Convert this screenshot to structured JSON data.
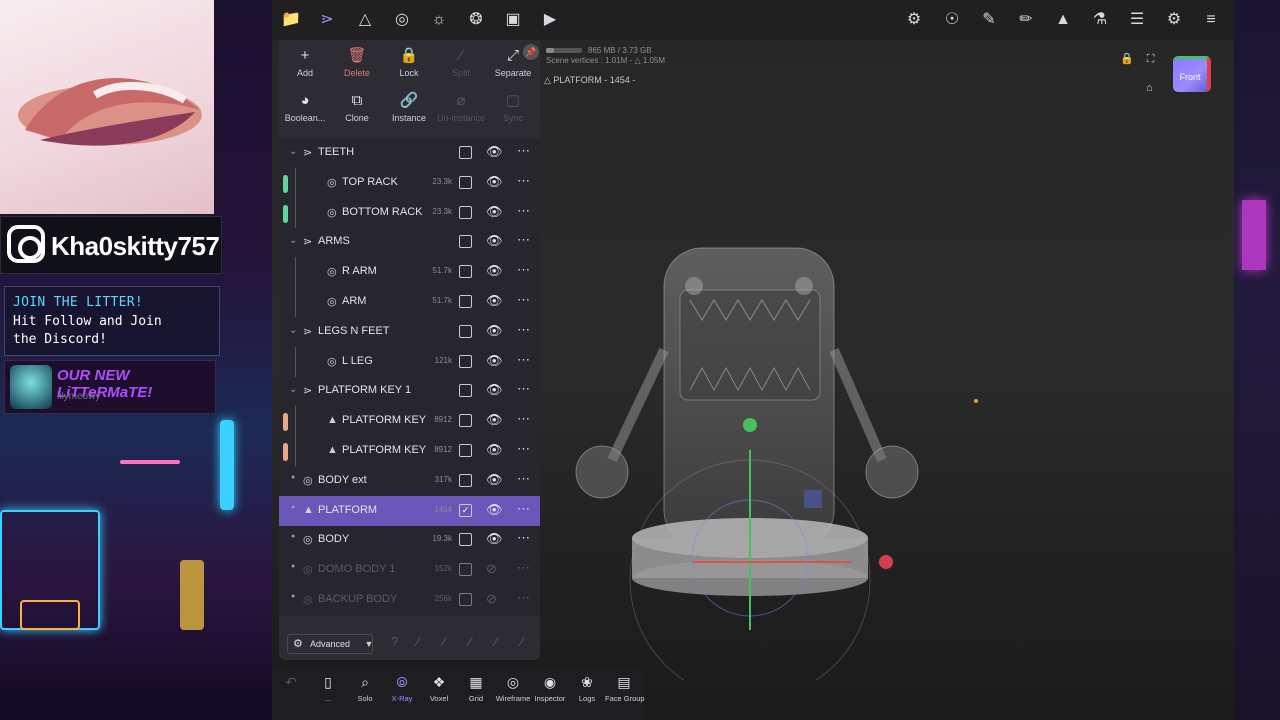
{
  "overlay": {
    "instagram_handle": "Kha0skitty757",
    "join_title": "JOIN THE LITTER!",
    "join_subtitle": "Hit Follow and Join the Discord!",
    "new_mate_title": "OUR NEW LiTTeRMaTE!",
    "new_mate_name": "lilymeowy"
  },
  "toolbar": {
    "actions": [
      {
        "label": "Add",
        "icon": "plus-icon",
        "enabled": true
      },
      {
        "label": "Delete",
        "icon": "trash-icon",
        "enabled": true,
        "accent": "#e07a7a"
      },
      {
        "label": "Lock",
        "icon": "lock-icon",
        "enabled": true
      },
      {
        "label": "Split",
        "icon": "split-icon",
        "enabled": false
      },
      {
        "label": "Separate",
        "icon": "expand-icon",
        "enabled": true
      },
      {
        "label": "Boolean...",
        "icon": "boolean-icon",
        "enabled": true
      },
      {
        "label": "Clone",
        "icon": "clone-icon",
        "enabled": true
      },
      {
        "label": "Instance",
        "icon": "link-icon",
        "enabled": true
      },
      {
        "label": "Un-instance",
        "icon": "unlink-icon",
        "enabled": false
      },
      {
        "label": "Sync",
        "icon": "sync-icon",
        "enabled": false
      }
    ]
  },
  "scene": {
    "rows": [
      {
        "name": "TEETH",
        "count": "",
        "type": "group",
        "level": 0,
        "checked": false,
        "visible": true
      },
      {
        "name": "TOP RACK",
        "count": "23.3k",
        "type": "mesh",
        "level": 1,
        "checked": false,
        "visible": true,
        "tag": "#5fd6a0"
      },
      {
        "name": "BOTTOM RACK",
        "count": "23.3k",
        "type": "mesh",
        "level": 1,
        "checked": false,
        "visible": true,
        "tag": "#5fd6a0"
      },
      {
        "name": "ARMS",
        "count": "",
        "type": "group",
        "level": 0,
        "checked": false,
        "visible": true
      },
      {
        "name": "R ARM",
        "count": "51.7k",
        "type": "mesh",
        "level": 1,
        "checked": false,
        "visible": true
      },
      {
        "name": "ARM",
        "count": "51.7k",
        "type": "mesh",
        "level": 1,
        "checked": false,
        "visible": true
      },
      {
        "name": "LEGS N FEET",
        "count": "",
        "type": "group",
        "level": 0,
        "checked": false,
        "visible": true
      },
      {
        "name": "L LEG",
        "count": "121k",
        "type": "mesh",
        "level": 1,
        "checked": false,
        "visible": true
      },
      {
        "name": "PLATFORM KEY 1",
        "count": "",
        "type": "group",
        "level": 0,
        "checked": false,
        "visible": true
      },
      {
        "name": "PLATFORM KEY",
        "count": "8912",
        "type": "tri",
        "level": 1,
        "checked": false,
        "visible": true,
        "tag": "#e8a88a"
      },
      {
        "name": "PLATFORM KEY",
        "count": "8912",
        "type": "tri",
        "level": 1,
        "checked": false,
        "visible": true,
        "tag": "#e8a88a"
      },
      {
        "name": "BODY ext",
        "count": "317k",
        "type": "mesh",
        "level": 0,
        "checked": false,
        "visible": true
      },
      {
        "name": "PLATFORM",
        "count": "1454",
        "type": "tri",
        "level": 0,
        "checked": true,
        "visible": true,
        "selected": true
      },
      {
        "name": "BODY",
        "count": "19.3k",
        "type": "mesh",
        "level": 0,
        "checked": false,
        "visible": true
      },
      {
        "name": "DOMO BODY 1",
        "count": "152k",
        "type": "mesh",
        "level": 0,
        "checked": false,
        "visible": false,
        "dim": true
      },
      {
        "name": "BACKUP BODY",
        "count": "256k",
        "type": "mesh",
        "level": 0,
        "checked": false,
        "visible": false,
        "dim": true
      }
    ]
  },
  "footer": {
    "advanced_label": "Advanced"
  },
  "stats": {
    "memory": "865 MB / 3.73 GB",
    "memory_fraction": 0.23,
    "vertices": "Scene vertices : 1.01M - △ 1.05M",
    "breadcrumb": "PLATFORM - 1454 -"
  },
  "view_cube": {
    "label": "Front"
  },
  "bottombar": {
    "items": [
      {
        "label": "",
        "icon": "undo-icon",
        "dim": true
      },
      {
        "label": "...",
        "icon": "phone-icon"
      },
      {
        "label": "Solo",
        "icon": "search-icon"
      },
      {
        "label": "X-Ray",
        "icon": "xray-icon",
        "active": true
      },
      {
        "label": "Voxel",
        "icon": "voxel-icon"
      },
      {
        "label": "Grid",
        "icon": "grid-icon"
      },
      {
        "label": "Wireframe",
        "icon": "wireframe-icon"
      },
      {
        "label": "Inspector",
        "icon": "inspector-icon"
      },
      {
        "label": "Logs",
        "icon": "bug-icon"
      },
      {
        "label": "Face Group",
        "icon": "facegroup-icon"
      }
    ]
  },
  "colors": {
    "accent": "#a58bff",
    "selected_row": "#6a55b8"
  }
}
